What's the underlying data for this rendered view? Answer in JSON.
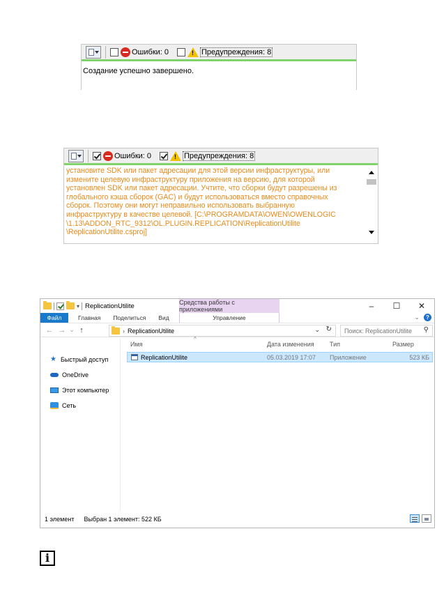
{
  "panel1": {
    "errors_label": "Ошибки: 0",
    "errors_checked": false,
    "warnings_label": "Предупреждения: 8",
    "warnings_checked": false,
    "message": "Создание успешно завершено."
  },
  "panel2": {
    "errors_label": "Ошибки: 0",
    "errors_checked": true,
    "warnings_label": "Предупреждения: 8",
    "warnings_checked": true,
    "lines": [
      "установите SDK или пакет адресации для этой версии инфраструктуры, или",
      "измените целевую инфраструктуру приложения на версию, для которой",
      "установлен SDK или пакет адресации. Учтите, что сборки будут разрешены из",
      "глобального кэша сборок (GAC) и будут использоваться вместо справочных",
      "сборок. Поэтому они могут неправильно использовать выбранную",
      "инфраструктуру в качестве целевой. [C:\\PROGRAMDATA\\OWEN\\OWENLOGIC",
      "\\1.13\\ADDON_RTC_9312\\OL.PLUGIN.REPLICATION\\ReplicationUtilite",
      "\\ReplicationUtilite.csproj]"
    ],
    "warning_color": "#e88a1a"
  },
  "explorer": {
    "title": "ReplicationUtilite",
    "context_tab_header": "Средства работы с приложениями",
    "window_buttons": {
      "minimize": "–",
      "maximize": "☐",
      "close": "✕"
    },
    "ribbon": {
      "file": "Файл",
      "tabs": [
        "Главная",
        "Поделиться",
        "Вид"
      ],
      "context_tab": "Управление"
    },
    "nav": {
      "back": "←",
      "forward": "→",
      "recent": "⌄",
      "up": "↑"
    },
    "address": {
      "path": "ReplicationUtilite",
      "separator": "›"
    },
    "search_placeholder": "Поиск: ReplicationUtilite",
    "nav_pane": [
      "Быстрый доступ",
      "OneDrive",
      "Этот компьютер",
      "Сеть"
    ],
    "columns": {
      "name": "Имя",
      "date": "Дата изменения",
      "type": "Тип",
      "size": "Размер"
    },
    "files": [
      {
        "name": "ReplicationUtilite",
        "date": "05.03.2019 17:07",
        "type": "Приложение",
        "size": "523 КБ",
        "selected": true
      }
    ],
    "status": {
      "count": "1 элемент",
      "selection": "Выбран 1 элемент: 522 КБ"
    },
    "accent_color": "#1979ca",
    "context_color": "#e8d3f1"
  },
  "info_icon_glyph": "i"
}
